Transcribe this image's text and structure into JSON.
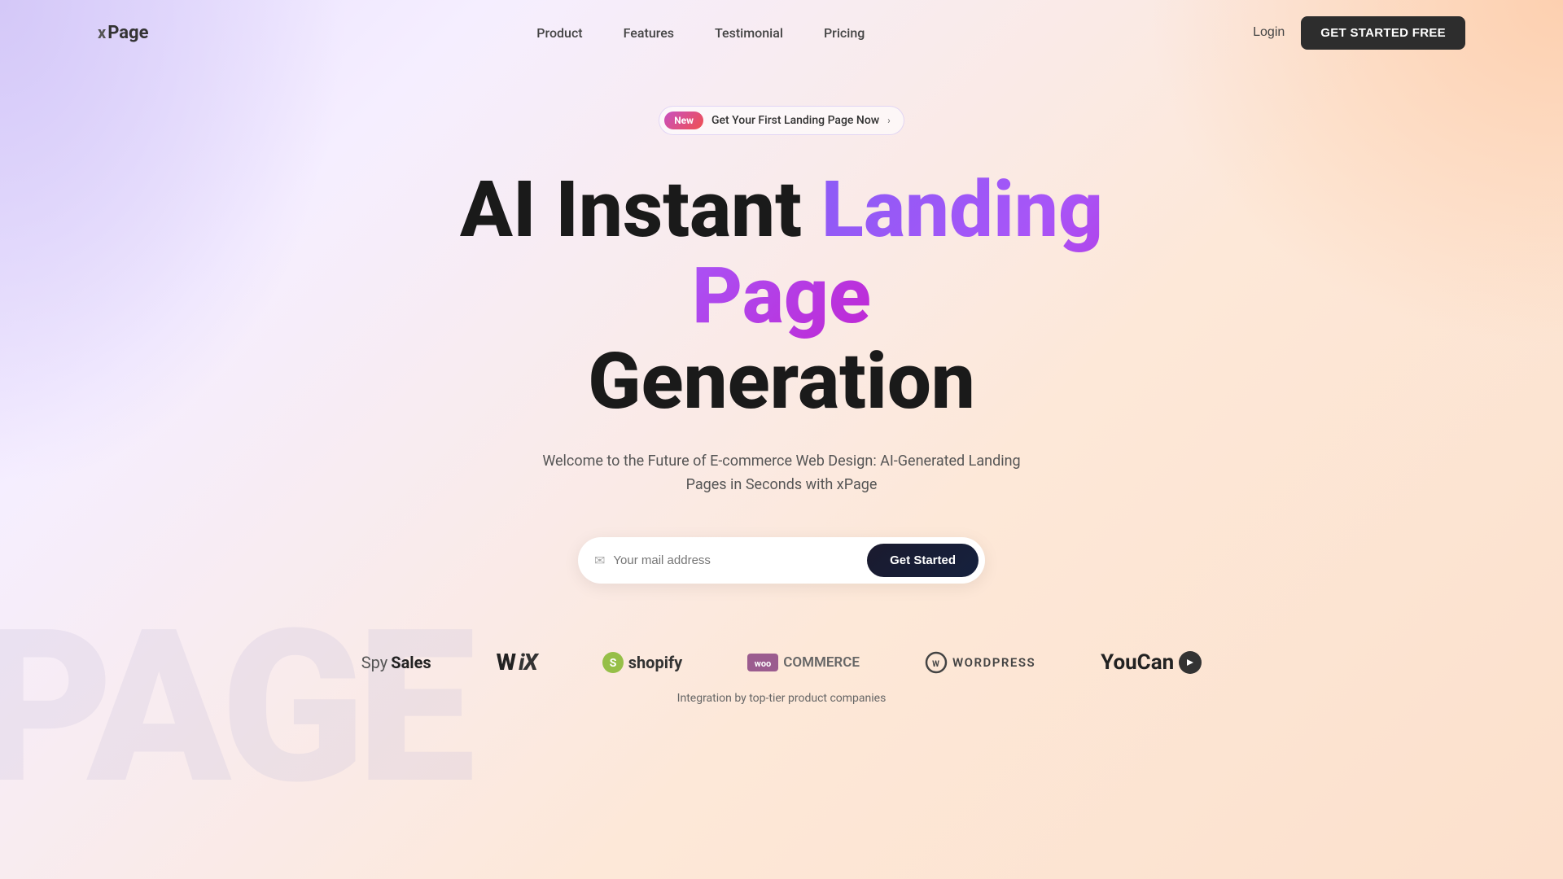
{
  "brand": {
    "logo_prefix": "x",
    "logo_name": "Page"
  },
  "nav": {
    "links": [
      {
        "label": "Product",
        "href": "#"
      },
      {
        "label": "Features",
        "href": "#"
      },
      {
        "label": "Testimonial",
        "href": "#"
      },
      {
        "label": "Pricing",
        "href": "#"
      }
    ],
    "login_label": "Login",
    "cta_label": "GET STARTED FREE"
  },
  "announcement": {
    "badge_label": "New",
    "text": "Get Your First Landing Page Now",
    "arrow": "›"
  },
  "hero": {
    "title_line1": "AI Instant ",
    "title_line1_gradient": "Landing Page",
    "title_line2": "Generation",
    "subtitle": "Welcome to the Future of E-commerce Web Design: AI-Generated Landing Pages in Seconds with xPage"
  },
  "email_form": {
    "placeholder": "Your mail address",
    "submit_label": "Get Started",
    "icon": "✉"
  },
  "partners": {
    "integration_text": "Integration by top-tier product companies",
    "logos": [
      {
        "name": "SpySales",
        "type": "spysales"
      },
      {
        "name": "WiX",
        "type": "wix"
      },
      {
        "name": "Shopify",
        "type": "shopify"
      },
      {
        "name": "WooCommerce",
        "type": "woocommerce"
      },
      {
        "name": "WordPress",
        "type": "wordpress"
      },
      {
        "name": "YouCan",
        "type": "youcan"
      }
    ]
  },
  "watermark": {
    "text": "PAGE"
  }
}
